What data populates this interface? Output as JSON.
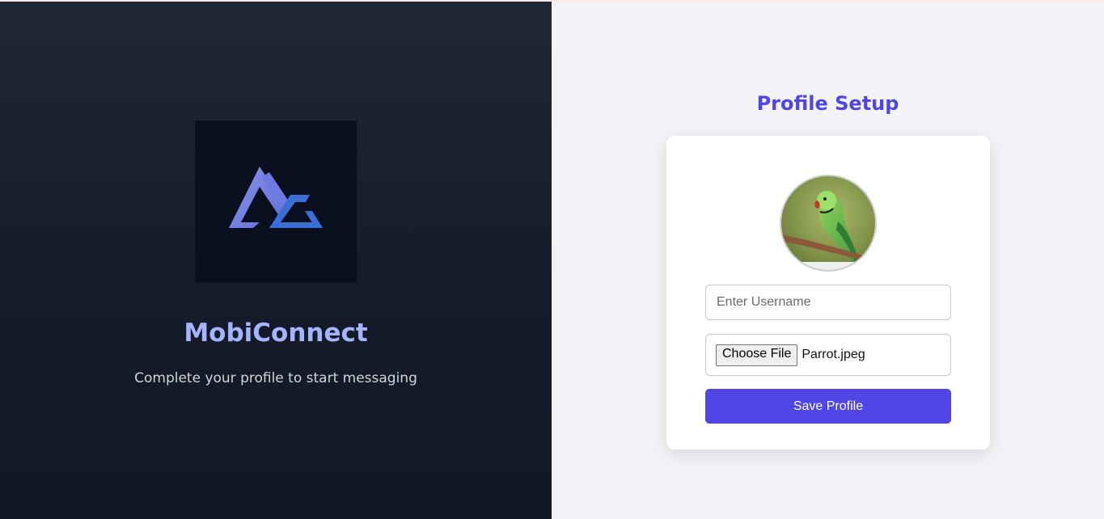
{
  "brand": {
    "name": "MobiConnect",
    "tagline": "Complete your profile to start messaging"
  },
  "profile_setup": {
    "title": "Profile Setup",
    "username": {
      "placeholder": "Enter Username",
      "value": ""
    },
    "file_input": {
      "button_label": "Choose File",
      "file_name": "Parrot.jpeg"
    },
    "save_label": "Save Profile",
    "avatar_image": "parrot-photo"
  },
  "colors": {
    "accent": "#4f46e5",
    "brand_text": "#a5b4fc",
    "left_panel_bg": "#1a2130",
    "right_panel_bg": "#f3f2f7"
  }
}
